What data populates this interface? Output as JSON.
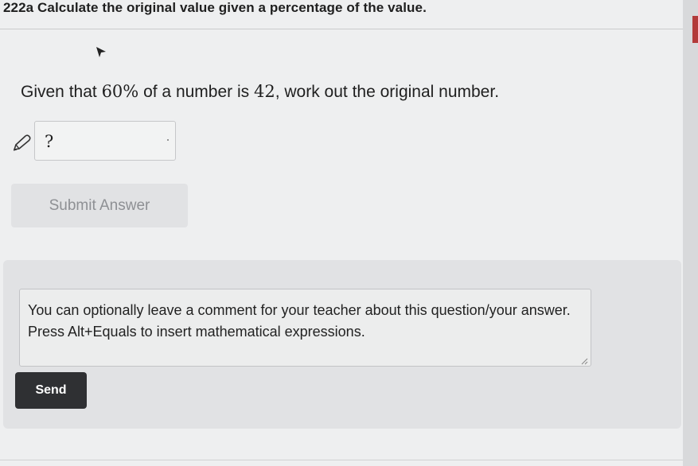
{
  "header": {
    "title": "222a Calculate the original value given a percentage of the value."
  },
  "question": {
    "prefix": "Given that ",
    "percent": "60%",
    "middle": " of a number is ",
    "value": "42",
    "suffix": ", work out the original number."
  },
  "answer": {
    "value": "?",
    "icon": "pencil-icon"
  },
  "submit": {
    "label": "Submit Answer",
    "state": "disabled"
  },
  "comment": {
    "placeholder": "You can optionally leave a comment for your teacher about this question/your answer. Press Alt+Equals to insert mathematical expressions."
  },
  "send": {
    "label": "Send"
  },
  "colors": {
    "send_button": "#2f3033",
    "submit_disabled_bg": "#e1e2e4",
    "accent": "#b23a3a"
  }
}
